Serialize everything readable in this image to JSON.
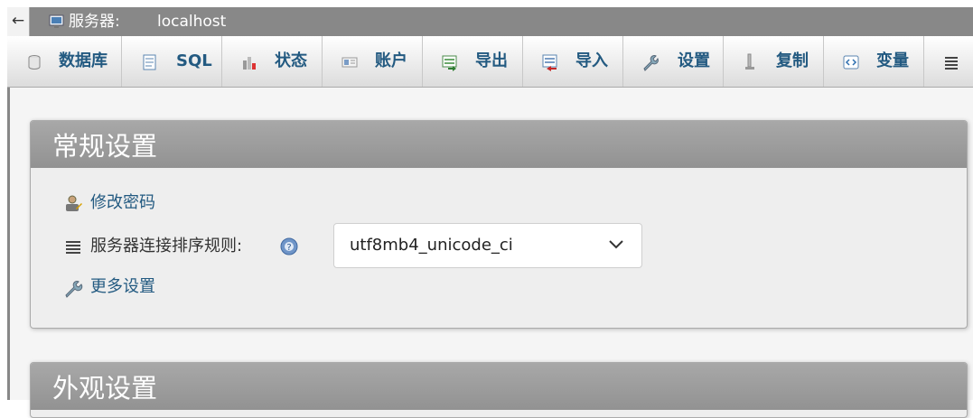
{
  "header": {
    "back": "←",
    "server_label": "服务器:",
    "server_name": "localhost"
  },
  "tabs": [
    {
      "label": "数据库",
      "icon": "database-icon"
    },
    {
      "label": "SQL",
      "icon": "sql-icon"
    },
    {
      "label": "状态",
      "icon": "status-chart-icon"
    },
    {
      "label": "账户",
      "icon": "accounts-icon"
    },
    {
      "label": "导出",
      "icon": "export-icon"
    },
    {
      "label": "导入",
      "icon": "import-icon"
    },
    {
      "label": "设置",
      "icon": "wrench-icon"
    },
    {
      "label": "复制",
      "icon": "replication-icon"
    },
    {
      "label": "变量",
      "icon": "variables-icon"
    },
    {
      "label": "",
      "icon": "more-icon"
    }
  ],
  "general": {
    "title": "常规设置",
    "change_password": "修改密码",
    "collation_label": "服务器连接排序规则:",
    "collation_value": "utf8mb4_unicode_ci",
    "more_settings": "更多设置"
  },
  "appearance": {
    "title": "外观设置"
  },
  "colors": {
    "link": "#235a81",
    "header_gray": "#888888"
  }
}
